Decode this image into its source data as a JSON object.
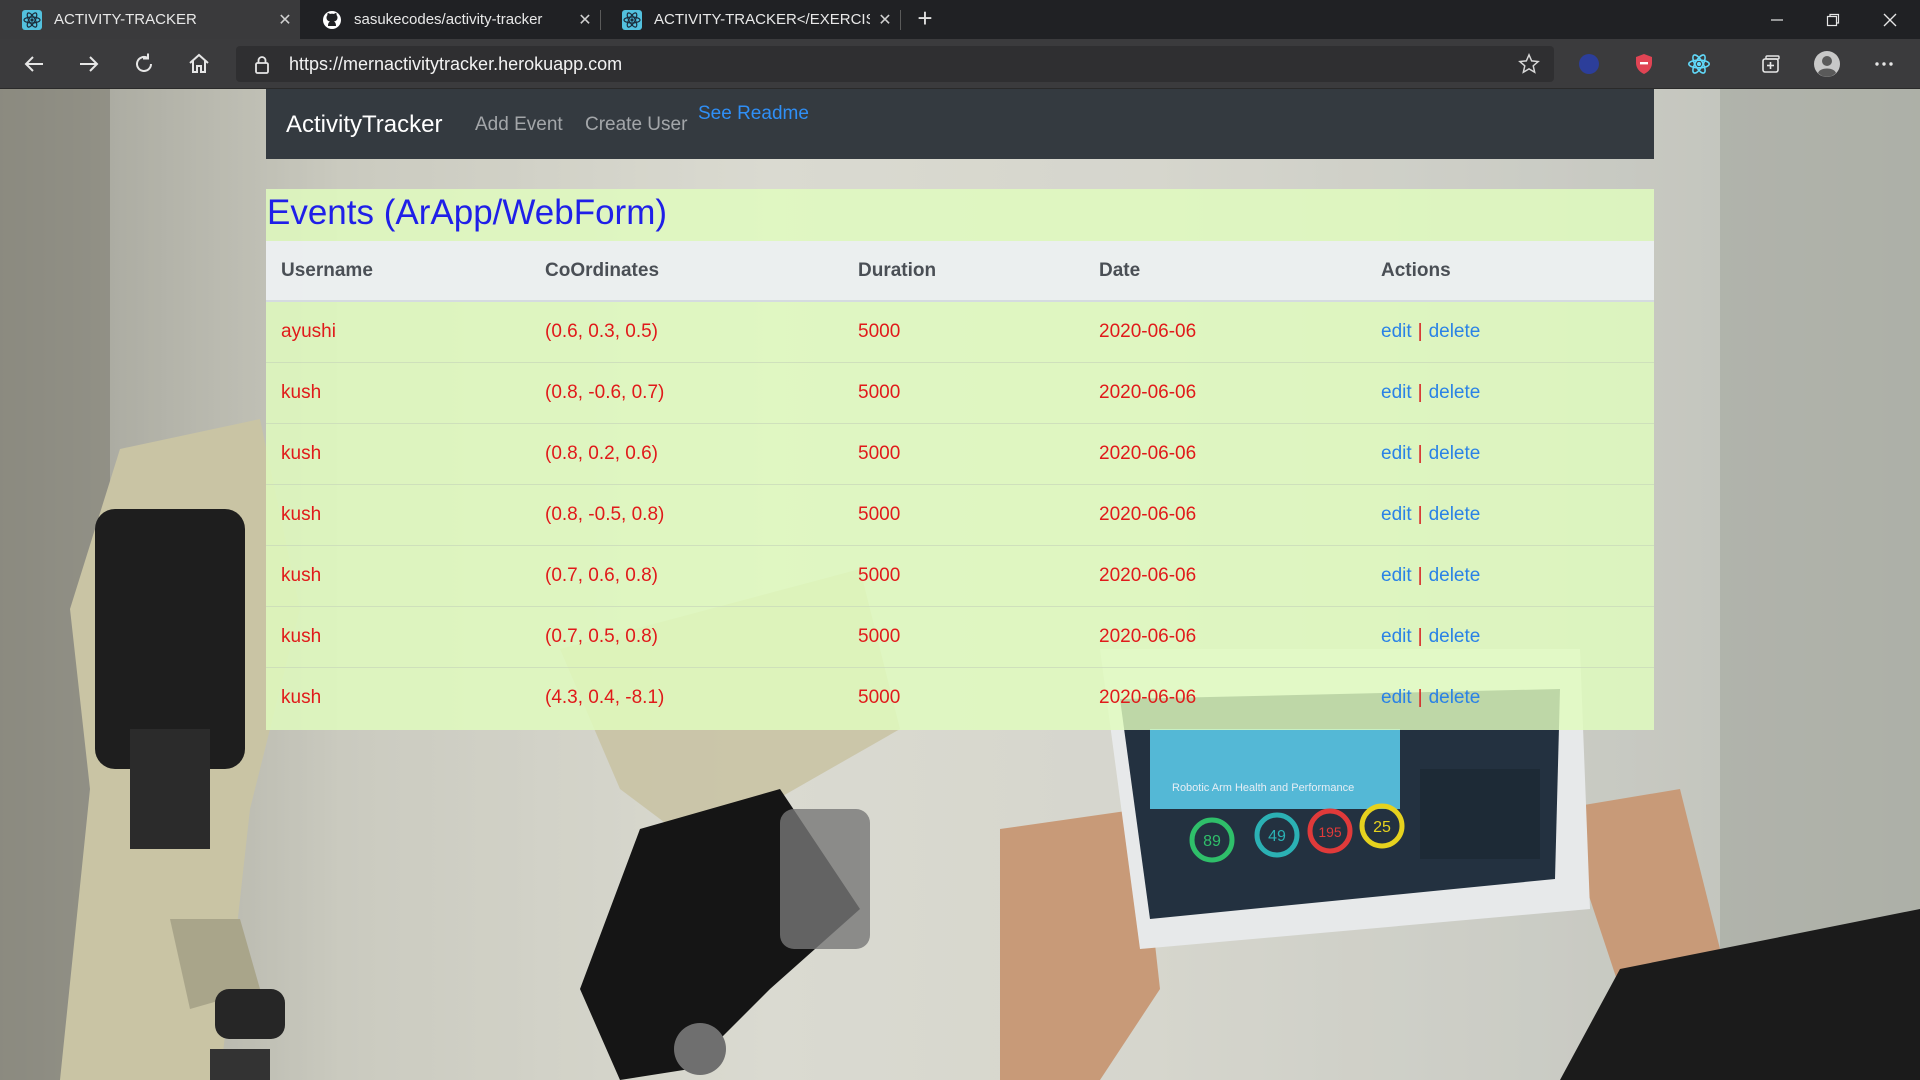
{
  "browser": {
    "tabs": [
      {
        "title": "ACTIVITY-TRACKER",
        "icon": "react-icon",
        "active": true
      },
      {
        "title": "sasukecodes/activity-tracker",
        "icon": "github-icon",
        "active": false
      },
      {
        "title": "ACTIVITY-TRACKER</EXERCISE-T",
        "icon": "react-icon",
        "active": false
      }
    ],
    "new_tab": "+",
    "close_glyph": "✕",
    "url": "https://mernactivitytracker.herokuapp.com"
  },
  "navbar": {
    "brand": "ActivityTracker",
    "links": [
      "Add Event",
      "Create User"
    ],
    "readme": "See Readme"
  },
  "events": {
    "heading": "Events (ArApp/WebForm)",
    "columns": [
      "Username",
      "CoOrdinates",
      "Duration",
      "Date",
      "Actions"
    ],
    "rows": [
      {
        "username": "ayushi",
        "coords": "(0.6, 0.3, 0.5)",
        "duration": "5000",
        "date": "2020-06-06"
      },
      {
        "username": "kush",
        "coords": "(0.8, -0.6, 0.7)",
        "duration": "5000",
        "date": "2020-06-06"
      },
      {
        "username": "kush",
        "coords": "(0.8, 0.2, 0.6)",
        "duration": "5000",
        "date": "2020-06-06"
      },
      {
        "username": "kush",
        "coords": "(0.8, -0.5, 0.8)",
        "duration": "5000",
        "date": "2020-06-06"
      },
      {
        "username": "kush",
        "coords": "(0.7, 0.6, 0.8)",
        "duration": "5000",
        "date": "2020-06-06"
      },
      {
        "username": "kush",
        "coords": "(0.7, 0.5, 0.8)",
        "duration": "5000",
        "date": "2020-06-06"
      },
      {
        "username": "kush",
        "coords": "(4.3, 0.4, -8.1)",
        "duration": "5000",
        "date": "2020-06-06"
      }
    ],
    "edit_label": "edit",
    "separator": "|",
    "delete_label": "delete"
  },
  "background": {
    "tablet_panel_title": "Robotic Arm Health and Performance",
    "gauges": [
      "89",
      "49",
      "195",
      "25"
    ]
  },
  "colors": {
    "nav_bg": "#343a40",
    "heading": "#1f1fe8",
    "cell_text": "#e01a1a",
    "link": "#2a82e6",
    "panel_bg": "#e1fdbe"
  }
}
